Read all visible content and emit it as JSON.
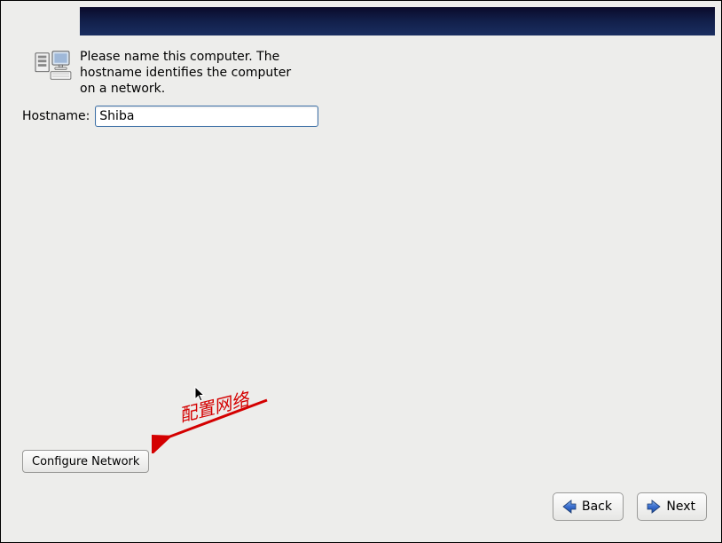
{
  "intro_text": "Please name this computer.  The hostname identifies the computer on a network.",
  "hostname": {
    "label": "Hostname:",
    "value": "Shiba"
  },
  "buttons": {
    "configure_network": "Configure Network",
    "back": "Back",
    "next": "Next"
  },
  "annotation": "配置网络"
}
